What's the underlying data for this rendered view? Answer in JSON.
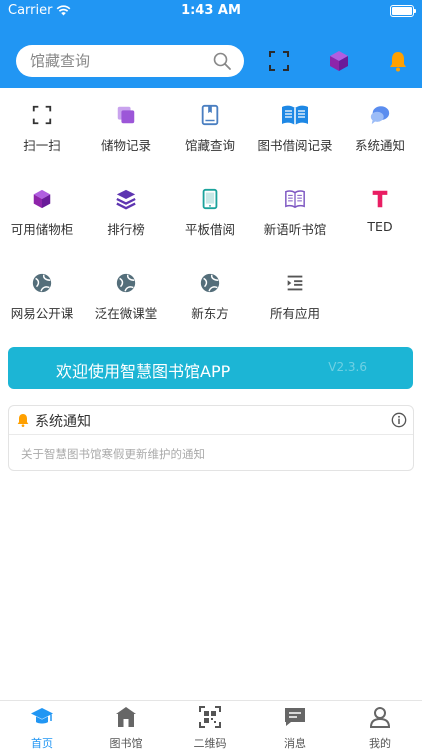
{
  "status_bar": {
    "carrier": "Carrier",
    "time": "1:43 AM"
  },
  "search": {
    "placeholder": "馆藏查询"
  },
  "header_icons": [
    "scan-icon",
    "cube-icon",
    "bell-icon"
  ],
  "grid": [
    {
      "label": "扫一扫",
      "icon": "scan-icon",
      "color": "#333333"
    },
    {
      "label": "储物记录",
      "icon": "stack-icon",
      "color": "#9C56D8"
    },
    {
      "label": "馆藏查询",
      "icon": "book-icon",
      "color": "#4A7FC1"
    },
    {
      "label": "图书借阅记录",
      "icon": "open-book-icon",
      "color": "#1E88E5"
    },
    {
      "label": "系统通知",
      "icon": "chat-bubble-icon",
      "color": "#5B8DEF"
    },
    {
      "label": "可用储物柜",
      "icon": "cube-icon",
      "color": "#8E24AA"
    },
    {
      "label": "排行榜",
      "icon": "layers-icon",
      "color": "#5E35B1"
    },
    {
      "label": "平板借阅",
      "icon": "tablet-icon",
      "color": "#1BA39C"
    },
    {
      "label": "新语听书馆",
      "icon": "open-book-outline-icon",
      "color": "#7E57C2"
    },
    {
      "label": "TED",
      "icon": "ted-icon",
      "color": "#E91E63"
    },
    {
      "label": "网易公开课",
      "icon": "globe-icon",
      "color": "#546E7A"
    },
    {
      "label": "泛在微课堂",
      "icon": "globe-icon",
      "color": "#546E7A"
    },
    {
      "label": "新东方",
      "icon": "globe-icon",
      "color": "#546E7A"
    },
    {
      "label": "所有应用",
      "icon": "list-icon",
      "color": "#555555"
    }
  ],
  "banner": {
    "title": "欢迎使用智慧图书馆APP",
    "version": "V2.3.6"
  },
  "notice": {
    "title": "系统通知",
    "text": "关于智慧图书馆寒假更新维护的通知"
  },
  "tabbar": [
    {
      "label": "首页",
      "icon": "graduation-cap-icon",
      "active": true
    },
    {
      "label": "图书馆",
      "icon": "library-icon",
      "active": false
    },
    {
      "label": "二维码",
      "icon": "qr-code-icon",
      "active": false
    },
    {
      "label": "消息",
      "icon": "message-icon",
      "active": false
    },
    {
      "label": "我的",
      "icon": "user-icon",
      "active": false
    }
  ],
  "colors": {
    "primary": "#2196F3",
    "banner": "#1CB5D5",
    "bell": "#FFA000"
  }
}
